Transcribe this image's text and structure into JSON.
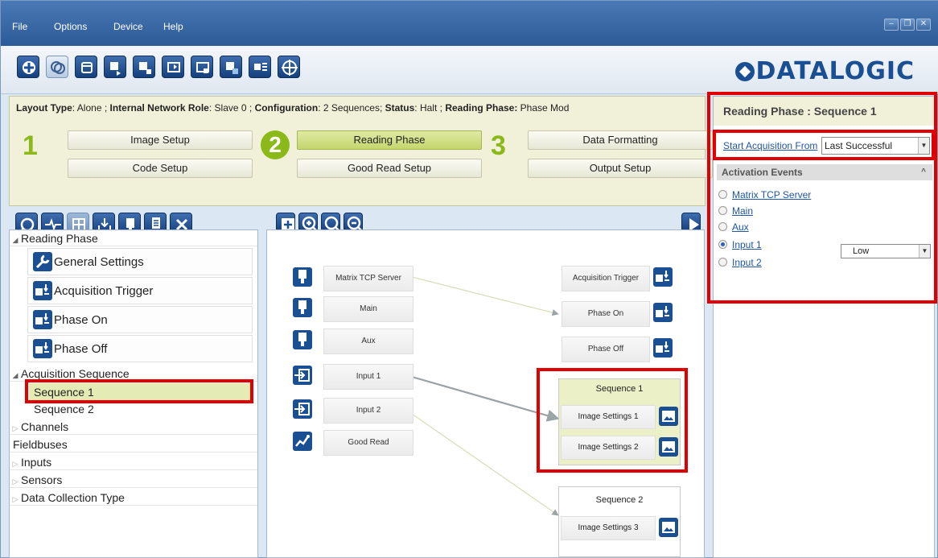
{
  "menu": {
    "file": "File",
    "options": "Options",
    "device": "Device",
    "help": "Help"
  },
  "window_controls": {
    "minimize": "–",
    "maximize": "❐",
    "close": "✕"
  },
  "brand": {
    "logo_text": "DATALOGIC",
    "accent": "#1b4f94"
  },
  "status_line": {
    "layout_type_label": "Layout Type",
    "layout_type_value": ": Alone ; ",
    "network_role_label": "Internal Network Role",
    "network_role_value": ": Slave 0 ; ",
    "configuration_label": "Configuration",
    "configuration_value": ": 2 Sequences; ",
    "status_label": "Status",
    "status_value": ": Halt ; ",
    "reading_phase_label": "Reading Phase:",
    "reading_phase_value": " Phase Mod"
  },
  "wizard": {
    "step1": "1",
    "step2": "2",
    "step3": "3",
    "image_setup": "Image Setup",
    "code_setup": "Code Setup",
    "reading_phase": "Reading Phase",
    "good_read_setup": "Good Read Setup",
    "data_formatting": "Data Formatting",
    "output_setup": "Output Setup",
    "selected_color": "#c5d66d"
  },
  "tree": {
    "reading_phase": "Reading Phase",
    "general_settings": "General Settings",
    "acquisition_trigger": "Acquisition Trigger",
    "phase_on": "Phase On",
    "phase_off": "Phase Off",
    "acquisition_sequence": "Acquisition Sequence",
    "sequence1": "Sequence  1",
    "sequence2": "Sequence  2",
    "channels": "Channels",
    "fieldbuses": "Fieldbuses",
    "inputs": "Inputs",
    "sensors": "Sensors",
    "data_collection_type": "Data Collection Type"
  },
  "diagram": {
    "sources": {
      "matrix_tcp_server": "Matrix TCP Server",
      "main": "Main",
      "aux": "Aux",
      "input1": "Input 1",
      "input2": "Input 2",
      "good_read": "Good Read"
    },
    "targets": {
      "acquisition_trigger": "Acquisition Trigger",
      "phase_on": "Phase On",
      "phase_off": "Phase Off"
    },
    "sequence1": {
      "title": "Sequence  1",
      "rows": [
        "Image Settings  1",
        "Image Settings  2"
      ]
    },
    "sequence2": {
      "title": "Sequence  2",
      "rows": [
        "Image Settings  3"
      ]
    }
  },
  "props": {
    "title": "Reading Phase :  Sequence 1",
    "start_acquisition_label": "Start Acquisition From",
    "start_acquisition_value": "Last Successful",
    "activation_events_header": "Activation Events",
    "events": [
      {
        "label": "Matrix TCP Server",
        "selected": false
      },
      {
        "label": "Main",
        "selected": false
      },
      {
        "label": "Aux",
        "selected": false
      },
      {
        "label": "Input 1",
        "selected": true
      },
      {
        "label": "Input 2",
        "selected": false
      }
    ],
    "input1_level": "Low"
  },
  "highlight_color": "#e00000"
}
